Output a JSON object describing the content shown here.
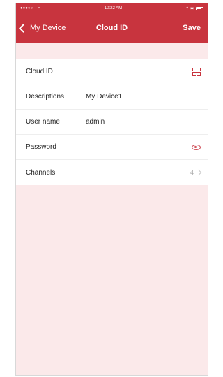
{
  "status_bar": {
    "carrier": "●●●○○",
    "time": "10:22 AM",
    "indicators": "⇡ ✱"
  },
  "nav": {
    "back_label": "My Device",
    "title": "Cloud ID",
    "save_label": "Save"
  },
  "form": {
    "rows": [
      {
        "label": "Cloud ID",
        "value": "",
        "icon": "scan-qr-icon"
      },
      {
        "label": "Descriptions",
        "value": "My Device1"
      },
      {
        "label": "User name",
        "value": "admin"
      },
      {
        "label": "Password",
        "value": "",
        "icon": "eye-icon"
      },
      {
        "label": "Channels",
        "value": "",
        "count": "4"
      }
    ]
  },
  "colors": {
    "accent": "#c8343e",
    "background": "#fbe9ea"
  }
}
